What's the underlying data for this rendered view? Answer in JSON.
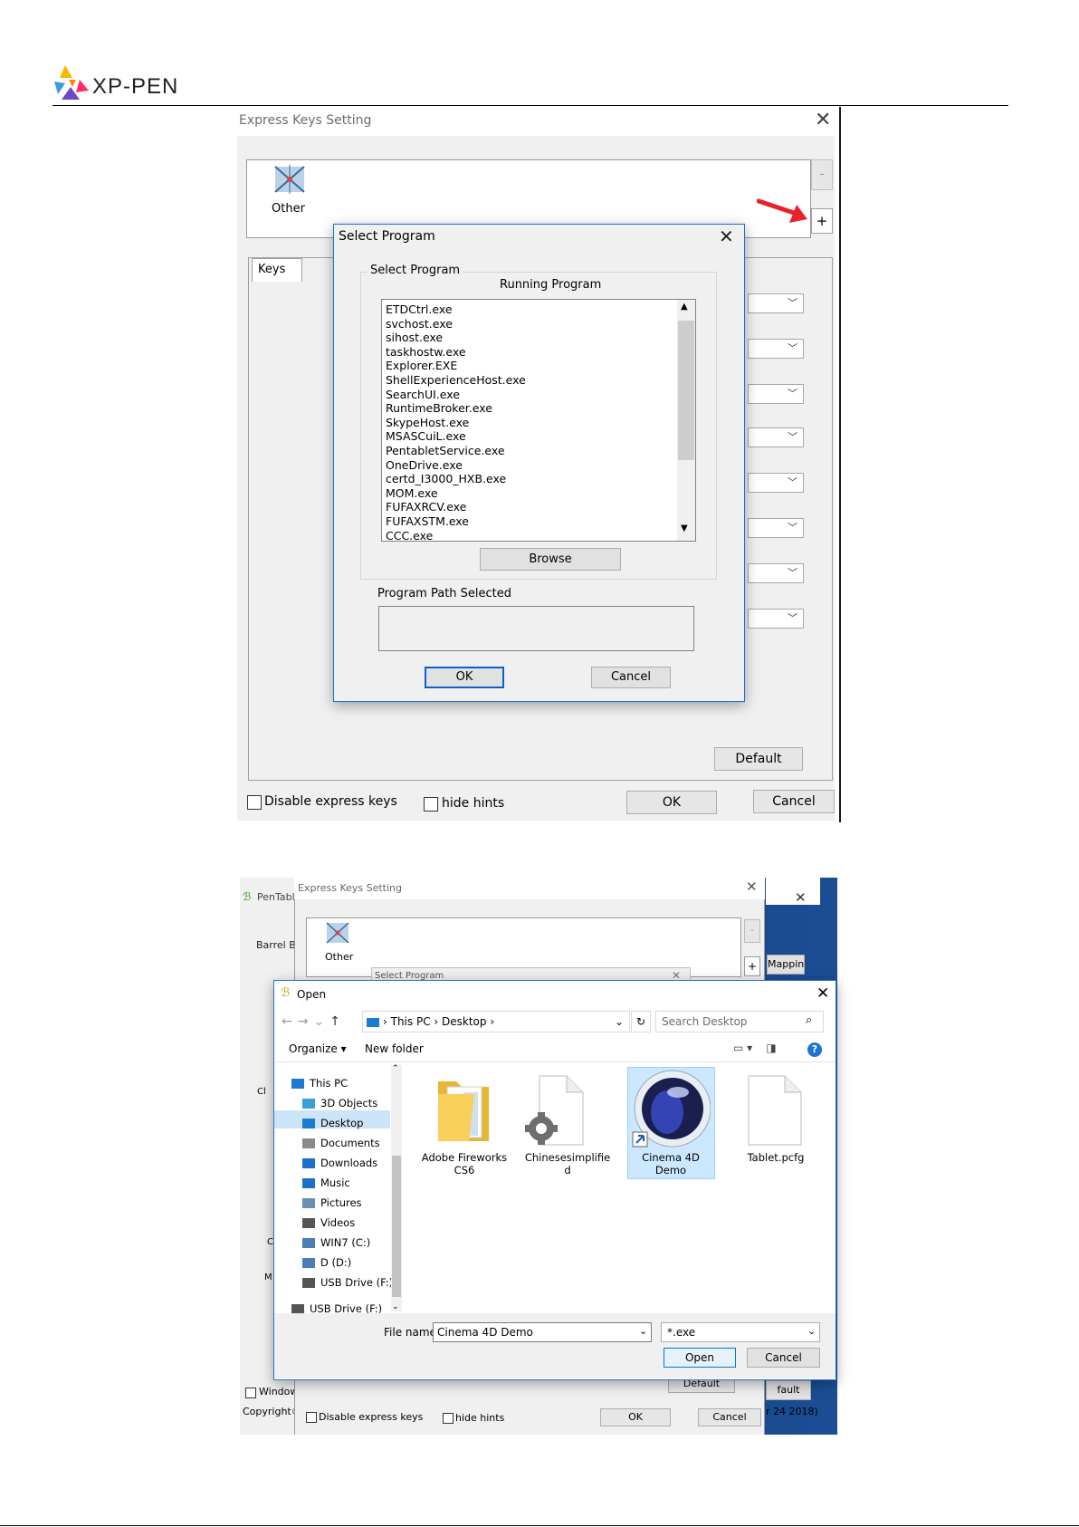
{
  "header": {
    "brand": "XP-PEN"
  },
  "express_keys_dialog": {
    "title": "Express Keys Setting",
    "program_label": "Other",
    "remove_button": "-",
    "add_button": "+",
    "tab_keys": "Keys",
    "default_button": "Default",
    "disable_label": "Disable express keys",
    "hide_hints_label": "hide hints",
    "ok_button": "OK",
    "cancel_button": "Cancel"
  },
  "select_program_dialog": {
    "title": "Select Program",
    "group_label": "Select Program",
    "running_label": "Running Program",
    "programs": [
      "ETDCtrl.exe",
      "svchost.exe",
      "sihost.exe",
      "taskhostw.exe",
      "Explorer.EXE",
      "ShellExperienceHost.exe",
      "SearchUI.exe",
      "RuntimeBroker.exe",
      "SkypeHost.exe",
      "MSASCuiL.exe",
      "PentabletService.exe",
      "OneDrive.exe",
      "certd_I3000_HXB.exe",
      "MOM.exe",
      "FUFAXRCV.exe",
      "FUFAXSTM.exe",
      "CCC.exe"
    ],
    "browse_button": "Browse",
    "path_label": "Program Path Selected",
    "ok_button": "OK",
    "cancel_button": "Cancel"
  },
  "screenshot2": {
    "pentablet_title": "PenTabl",
    "barrel_label": "Barrel Bu",
    "mapping_button": "Mappin",
    "window_label": "Window",
    "copyright": "Copyright©",
    "default_fragment": "fault",
    "date_fragment": "r 24 2018)",
    "side_letters": [
      "Cl",
      "C",
      "M"
    ],
    "express_title": "Express Keys Setting",
    "other_label": "Other",
    "remove_button": "-",
    "add_button": "+",
    "select_program_title": "Select Program",
    "default_button": "Default",
    "disable_label": "Disable express keys",
    "hide_hints_label": "hide hints",
    "ok_button": "OK",
    "cancel_button": "Cancel"
  },
  "open_dialog": {
    "title": "Open",
    "path_segments": [
      "This PC",
      "Desktop"
    ],
    "search_placeholder": "Search Desktop",
    "organize": "Organize ▾",
    "new_folder": "New folder",
    "nav_items": [
      {
        "label": "This PC",
        "icon": "pc-icon"
      },
      {
        "label": "3D Objects",
        "icon": "cube-icon"
      },
      {
        "label": "Desktop",
        "icon": "desktop-icon"
      },
      {
        "label": "Documents",
        "icon": "documents-icon"
      },
      {
        "label": "Downloads",
        "icon": "download-icon"
      },
      {
        "label": "Music",
        "icon": "music-icon"
      },
      {
        "label": "Pictures",
        "icon": "pictures-icon"
      },
      {
        "label": "Videos",
        "icon": "videos-icon"
      },
      {
        "label": "WIN7 (C:)",
        "icon": "drive-icon"
      },
      {
        "label": "D (D:)",
        "icon": "drive-icon"
      },
      {
        "label": "USB Drive (F:)",
        "icon": "usb-icon"
      },
      {
        "label": "USB Drive (F:)",
        "icon": "usb-icon"
      }
    ],
    "files": [
      {
        "name_line1": "Adobe Fireworks",
        "name_line2": "CS6",
        "icon": "folder-icon"
      },
      {
        "name_line1": "Chinesesimplifie",
        "name_line2": "d",
        "icon": "settings-file-icon"
      },
      {
        "name_line1": "Cinema 4D",
        "name_line2": "Demo",
        "icon": "cinema4d-icon"
      },
      {
        "name_line1": "Tablet.pcfg",
        "name_line2": "",
        "icon": "blank-file-icon"
      }
    ],
    "file_name_label": "File name:",
    "file_name_value": "Cinema 4D Demo",
    "file_type_value": "*.exe",
    "open_button": "Open",
    "cancel_button": "Cancel"
  },
  "colors": {
    "accent": "#1c6fc9",
    "arrow_red": "#e8222a",
    "selection": "#cce8ff",
    "desktop_bg": "#0b3b7a"
  }
}
